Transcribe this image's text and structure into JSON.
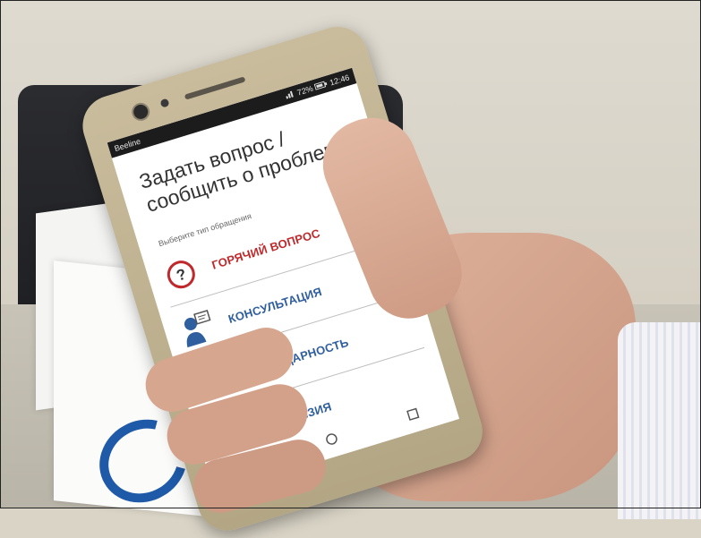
{
  "photo": {
    "phone_color": "#c2b594"
  },
  "statusbar": {
    "carrier": "Beeline",
    "battery": "72%",
    "time": "12:46"
  },
  "app": {
    "title_line1": "Задать вопрос /",
    "title_line2": "сообщить о проблеме",
    "prompt": "Выберите тип обращения",
    "accent_red": "#c0292b",
    "accent_blue": "#2f5f9e",
    "options": [
      {
        "label": "ГОРЯЧИЙ ВОПРОС",
        "icon": "question-circle-icon"
      },
      {
        "label": "КОНСУЛЬТАЦИЯ",
        "icon": "consultant-icon"
      },
      {
        "label": "БЛАГОДАРНОСТЬ",
        "icon": "thumbs-up-icon"
      },
      {
        "label": "ПРЕТЕНЗИЯ",
        "icon": "thumbs-down-icon"
      }
    ]
  },
  "navbar": {
    "back": "back-triangle-icon",
    "home": "home-circle-icon",
    "recents": "recents-square-icon"
  }
}
